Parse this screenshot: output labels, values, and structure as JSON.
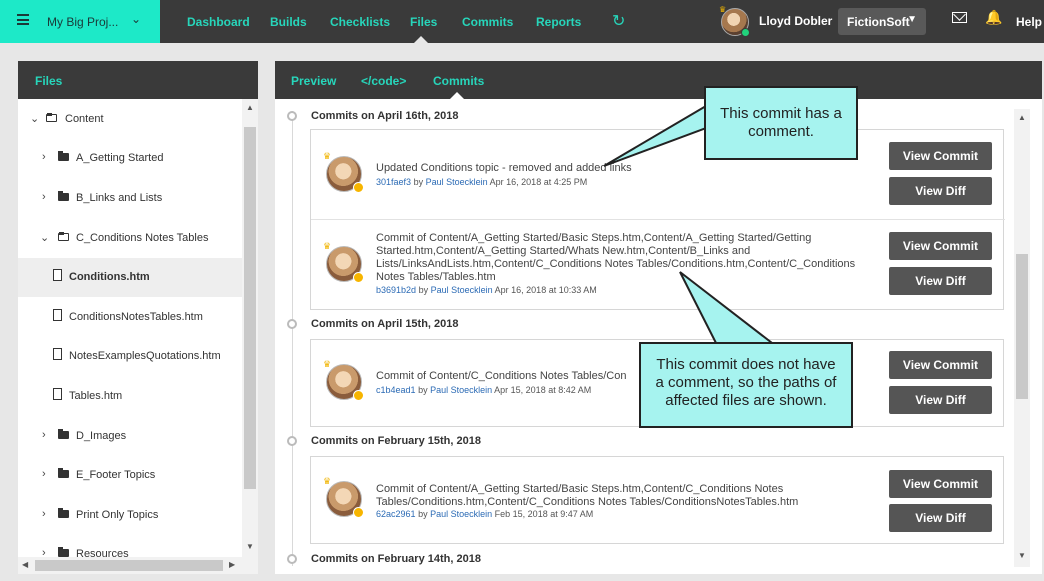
{
  "topbar": {
    "project_name": "My Big Proj...",
    "nav": [
      "Dashboard",
      "Builds",
      "Checklists",
      "Files",
      "Commits",
      "Reports"
    ],
    "active_nav": "Files",
    "user_name": "Lloyd Dobler",
    "org_name": "FictionSoft",
    "help_label": "Help"
  },
  "files_panel": {
    "title": "Files",
    "items": [
      {
        "label": "Content",
        "type": "folder-open",
        "level": 0,
        "expanded": true
      },
      {
        "label": "A_Getting Started",
        "type": "folder",
        "level": 1,
        "expanded": false
      },
      {
        "label": "B_Links and Lists",
        "type": "folder",
        "level": 1,
        "expanded": false
      },
      {
        "label": "C_Conditions Notes Tables",
        "type": "folder-open",
        "level": 1,
        "expanded": true
      },
      {
        "label": "Conditions.htm",
        "type": "file",
        "level": 2,
        "selected": true
      },
      {
        "label": "ConditionsNotesTables.htm",
        "type": "file",
        "level": 2
      },
      {
        "label": "NotesExamplesQuotations.htm",
        "type": "file",
        "level": 2
      },
      {
        "label": "Tables.htm",
        "type": "file",
        "level": 2
      },
      {
        "label": "D_Images",
        "type": "folder",
        "level": 1,
        "expanded": false
      },
      {
        "label": "E_Footer Topics",
        "type": "folder",
        "level": 1,
        "expanded": false
      },
      {
        "label": "Print Only Topics",
        "type": "folder",
        "level": 1,
        "expanded": false
      },
      {
        "label": "Resources",
        "type": "folder",
        "level": 1,
        "expanded": false
      }
    ]
  },
  "detail_panel": {
    "tabs": [
      "Preview",
      "</code>",
      "Commits"
    ],
    "active_tab": "Commits",
    "groups": [
      {
        "date_label": "Commits on April 16th, 2018",
        "commits": [
          {
            "message": "Updated Conditions topic - removed and added links",
            "hash": "301faef3",
            "by": "by",
            "author": "Paul Stoecklein",
            "time": "Apr 16, 2018 at 4:25 PM"
          },
          {
            "message": "Commit of Content/A_Getting Started/Basic Steps.htm,Content/A_Getting Started/Getting Started.htm,Content/A_Getting Started/Whats New.htm,Content/B_Links and Lists/LinksAndLists.htm,Content/C_Conditions Notes Tables/Conditions.htm,Content/C_Conditions Notes Tables/Tables.htm",
            "hash": "b3691b2d",
            "by": "by",
            "author": "Paul Stoecklein",
            "time": "Apr 16, 2018 at 10:33 AM"
          }
        ]
      },
      {
        "date_label": "Commits on April 15th, 2018",
        "commits": [
          {
            "message": "Commit of Content/C_Conditions Notes Tables/Con",
            "hash": "c1b4ead1",
            "by": "by",
            "author": "Paul Stoecklein",
            "time": "Apr 15, 2018 at 8:42 AM"
          }
        ]
      },
      {
        "date_label": "Commits on February 15th, 2018",
        "commits": [
          {
            "message": "Commit of Content/A_Getting Started/Basic Steps.htm,Content/C_Conditions Notes Tables/Conditions.htm,Content/C_Conditions Notes Tables/ConditionsNotesTables.htm",
            "hash": "62ac2961",
            "by": "by",
            "author": "Paul Stoecklein",
            "time": "Feb 15, 2018 at 9:47 AM"
          }
        ]
      },
      {
        "date_label": "Commits on February 14th, 2018",
        "commits": []
      }
    ],
    "view_commit_label": "View Commit",
    "view_diff_label": "View Diff"
  },
  "callouts": {
    "top": "This commit has a comment.",
    "bottom": "This commit does not have a comment, so the paths of affected files are shown."
  },
  "colors": {
    "accent": "#1de9c8",
    "nav_text": "#27d6bb",
    "topbar_bg": "#3a3a3a",
    "button_bg": "#555555",
    "callout_bg": "#a6f3ef",
    "status_badge": "#f7b500"
  }
}
